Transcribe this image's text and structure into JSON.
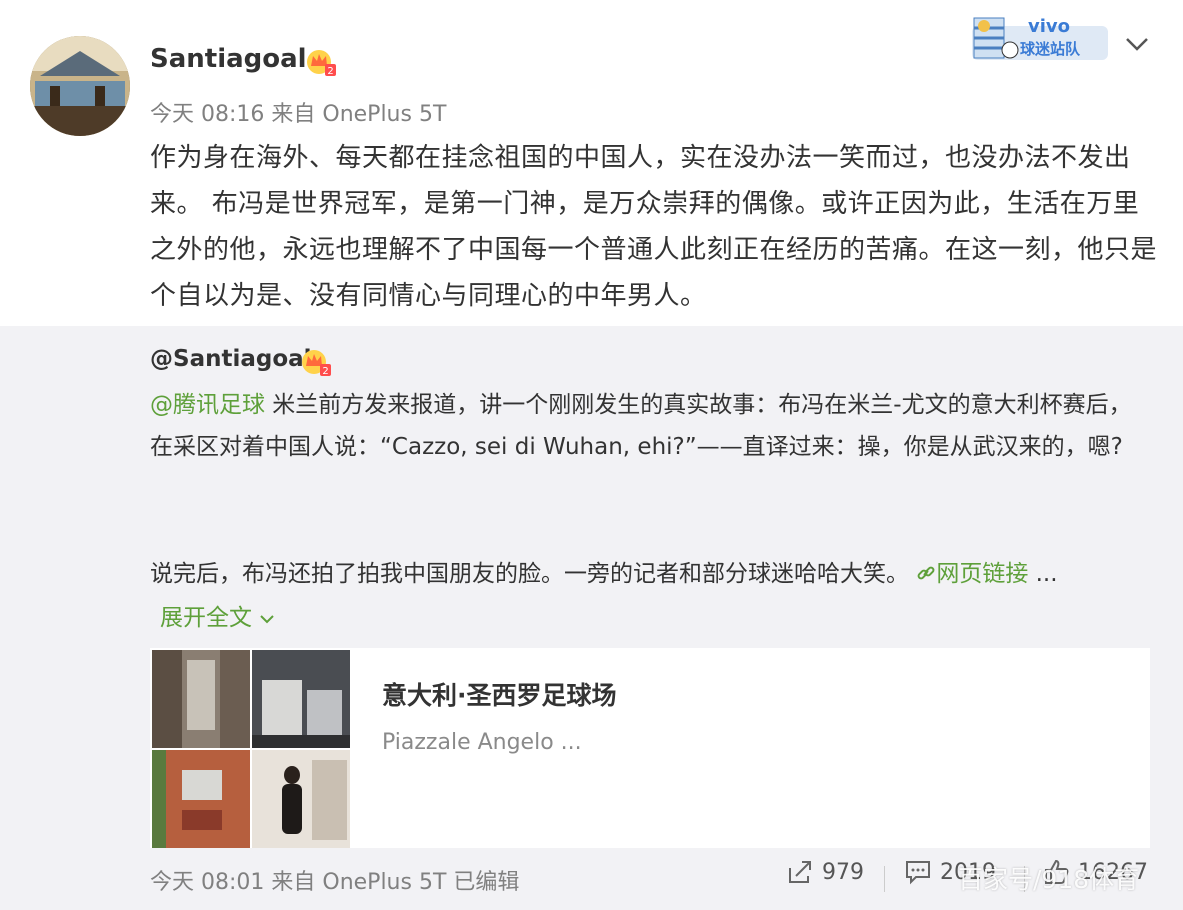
{
  "post": {
    "username": "Santiagoal",
    "meta": "今天 08:16 来自 OnePlus 5T",
    "text": "作为身在海外、每天都在挂念祖国的中国人，实在没办法一笑而过，也没办法不发出来。  布冯是世界冠军，是第一门神，是万众崇拜的偶像。或许正因为此，生活在万里之外的他，永远也理解不了中国每一个普通人此刻正在经历的苦痛。在这一刻，他只是个自以为是、没有同情心与同理心的中年男人。"
  },
  "badge": {
    "brand": "vivo",
    "label": "球迷站队"
  },
  "repost": {
    "user": "@Santiagoal",
    "mention": "@腾讯足球",
    "text": " 米兰前方发来报道，讲一个刚刚发生的真实故事：布冯在米兰-尤文的意大利杯赛后，在采区对着中国人说：“Cazzo, sei di Wuhan, ehi?”——直译过来：操，你是从武汉来的，嗯?",
    "line2": "说完后，布冯还拍了拍我中国朋友的脸。一旁的记者和部分球迷哈哈大笑。 ",
    "link_label": "网页链接",
    "ellipsis": " ...",
    "expand_label": "展开全文",
    "card": {
      "title": "意大利·圣西罗足球场",
      "subtitle": "Piazzale Angelo ..."
    },
    "footer_meta": "今天 08:01 来自 OnePlus 5T   已编辑",
    "share_count": "979",
    "comment_count": "2019",
    "like_count": "16267"
  },
  "watermark": "百家号/918体育",
  "colors": {
    "accent_green": "#5ea03a",
    "repost_bg": "#f2f2f5",
    "meta_gray": "#808080"
  }
}
